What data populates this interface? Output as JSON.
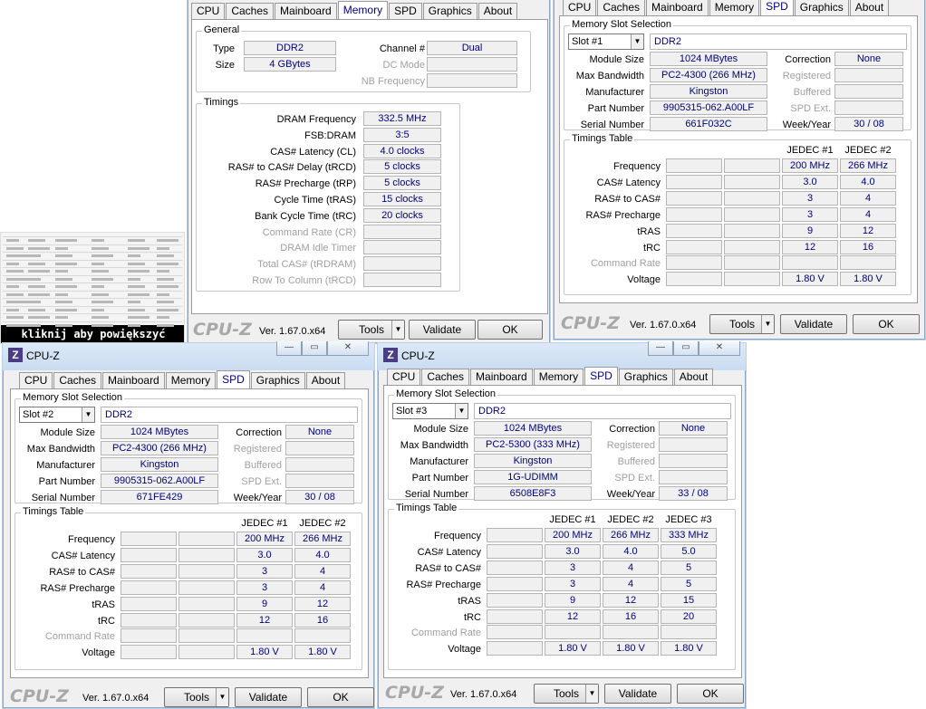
{
  "thumbnail": {
    "caption": "kliknij aby powiększyć"
  },
  "tab_labels": [
    "CPU",
    "Caches",
    "Mainboard",
    "Memory",
    "SPD",
    "Graphics",
    "About"
  ],
  "app_title": "CPU-Z",
  "footer": {
    "brand": "CPU-Z",
    "version": "Ver. 1.67.0.x64",
    "tools": "Tools",
    "validate": "Validate",
    "ok": "OK"
  },
  "memory_win": {
    "active_tab": "Memory",
    "general": {
      "title": "General",
      "type_label": "Type",
      "type": "DDR2",
      "channel_label": "Channel #",
      "channel": "Dual",
      "size_label": "Size",
      "size": "4 GBytes",
      "dc_mode_label": "DC Mode",
      "dc_mode": "",
      "nb_freq_label": "NB Frequency",
      "nb_freq": ""
    },
    "timings": {
      "title": "Timings",
      "rows": [
        {
          "label": "DRAM Frequency",
          "value": "332.5 MHz",
          "enabled": true
        },
        {
          "label": "FSB:DRAM",
          "value": "3:5",
          "enabled": true
        },
        {
          "label": "CAS# Latency (CL)",
          "value": "4.0 clocks",
          "enabled": true
        },
        {
          "label": "RAS# to CAS# Delay (tRCD)",
          "value": "5 clocks",
          "enabled": true
        },
        {
          "label": "RAS# Precharge (tRP)",
          "value": "5 clocks",
          "enabled": true
        },
        {
          "label": "Cycle Time (tRAS)",
          "value": "15 clocks",
          "enabled": true
        },
        {
          "label": "Bank Cycle Time (tRC)",
          "value": "20 clocks",
          "enabled": true
        },
        {
          "label": "Command Rate (CR)",
          "value": "",
          "enabled": false
        },
        {
          "label": "DRAM Idle Timer",
          "value": "",
          "enabled": false
        },
        {
          "label": "Total CAS# (tRDRAM)",
          "value": "",
          "enabled": false
        },
        {
          "label": "Row To Column (tRCD)",
          "value": "",
          "enabled": false
        }
      ]
    }
  },
  "spd_labels": {
    "slot_section": "Memory Slot Selection",
    "module_size": "Module Size",
    "max_bandwidth": "Max Bandwidth",
    "manufacturer": "Manufacturer",
    "part_number": "Part Number",
    "serial_number": "Serial Number",
    "correction": "Correction",
    "registered": "Registered",
    "buffered": "Buffered",
    "spd_ext": "SPD Ext.",
    "week_year": "Week/Year",
    "timings_table": "Timings Table",
    "rows": [
      "Frequency",
      "CAS# Latency",
      "RAS# to CAS#",
      "RAS# Precharge",
      "tRAS",
      "tRC",
      "Command Rate",
      "Voltage"
    ]
  },
  "spd1": {
    "active_tab": "SPD",
    "slot": "Slot #1",
    "type": "DDR2",
    "module_size": "1024 MBytes",
    "max_bandwidth": "PC2-4300 (266 MHz)",
    "manufacturer": "Kingston",
    "part_number": "9905315-062.A00LF",
    "serial_number": "661F032C",
    "correction": "None",
    "registered": "",
    "buffered": "",
    "spd_ext": "",
    "week_year": "30 / 08",
    "jedec_headers": [
      "JEDEC #1",
      "JEDEC #2"
    ],
    "jedec": [
      [
        "200 MHz",
        "266 MHz"
      ],
      [
        "3.0",
        "4.0"
      ],
      [
        "3",
        "4"
      ],
      [
        "3",
        "4"
      ],
      [
        "9",
        "12"
      ],
      [
        "12",
        "16"
      ],
      [
        "",
        ""
      ],
      [
        "1.80 V",
        "1.80 V"
      ]
    ]
  },
  "spd2": {
    "active_tab": "SPD",
    "slot": "Slot #2",
    "type": "DDR2",
    "module_size": "1024 MBytes",
    "max_bandwidth": "PC2-4300 (266 MHz)",
    "manufacturer": "Kingston",
    "part_number": "9905315-062.A00LF",
    "serial_number": "671FE429",
    "correction": "None",
    "registered": "",
    "buffered": "",
    "spd_ext": "",
    "week_year": "30 / 08",
    "jedec_headers": [
      "JEDEC #1",
      "JEDEC #2"
    ],
    "jedec": [
      [
        "200 MHz",
        "266 MHz"
      ],
      [
        "3.0",
        "4.0"
      ],
      [
        "3",
        "4"
      ],
      [
        "3",
        "4"
      ],
      [
        "9",
        "12"
      ],
      [
        "12",
        "16"
      ],
      [
        "",
        ""
      ],
      [
        "1.80 V",
        "1.80 V"
      ]
    ]
  },
  "spd3": {
    "active_tab": "SPD",
    "slot": "Slot #3",
    "type": "DDR2",
    "module_size": "1024 MBytes",
    "max_bandwidth": "PC2-5300 (333 MHz)",
    "manufacturer": "Kingston",
    "part_number": "1G-UDIMM",
    "serial_number": "6508E8F3",
    "correction": "None",
    "registered": "",
    "buffered": "",
    "spd_ext": "",
    "week_year": "33 / 08",
    "jedec_headers": [
      "JEDEC #1",
      "JEDEC #2",
      "JEDEC #3"
    ],
    "jedec": [
      [
        "200 MHz",
        "266 MHz",
        "333 MHz"
      ],
      [
        "3.0",
        "4.0",
        "5.0"
      ],
      [
        "3",
        "4",
        "5"
      ],
      [
        "3",
        "4",
        "5"
      ],
      [
        "9",
        "12",
        "15"
      ],
      [
        "12",
        "16",
        "20"
      ],
      [
        "",
        "",
        ""
      ],
      [
        "1.80 V",
        "1.80 V",
        "1.80 V"
      ]
    ]
  }
}
